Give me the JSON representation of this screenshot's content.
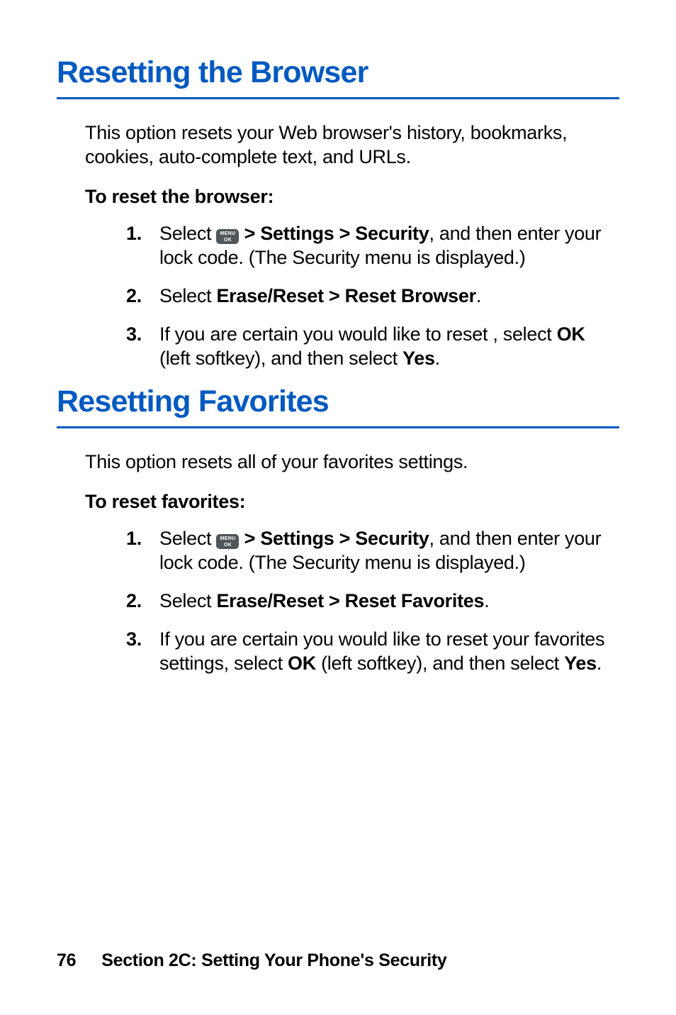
{
  "icons": {
    "menu_ok": {
      "top": "MENU",
      "bottom": "OK"
    }
  },
  "section1": {
    "title": "Resetting the Browser",
    "intro": "This option resets your Web browser's history, bookmarks, cookies, auto-complete text, and URLs.",
    "subhead": "To reset the browser:",
    "steps": {
      "s1": {
        "text_a": "Select ",
        "text_b": " > Settings > Security",
        "text_c": ", and then enter your lock code. (The Security menu is displayed.)"
      },
      "s2": {
        "text_a": "Select ",
        "text_b": "Erase/Reset > Reset Browser",
        "text_c": "."
      },
      "s3": {
        "text_a": "If you are certain you would like to reset , select ",
        "text_b": "OK",
        "text_c": " (left softkey), and then select ",
        "text_d": "Yes",
        "text_e": "."
      }
    }
  },
  "section2": {
    "title": "Resetting Favorites",
    "intro": "This option resets all of your favorites settings.",
    "subhead": "To reset favorites:",
    "steps": {
      "s1": {
        "text_a": "Select ",
        "text_b": " > Settings > Security",
        "text_c": ", and then enter your lock code. (The Security menu is displayed.)"
      },
      "s2": {
        "text_a": "Select ",
        "text_b": "Erase/Reset > Reset Favorites",
        "text_c": "."
      },
      "s3": {
        "text_a": "If you are certain you would like to reset your favorites settings, select ",
        "text_b": "OK",
        "text_c": " (left softkey), and then select ",
        "text_d": "Yes",
        "text_e": "."
      }
    }
  },
  "footer": {
    "page_number": "76",
    "section_label": "Section 2C: Setting Your Phone's Security"
  }
}
